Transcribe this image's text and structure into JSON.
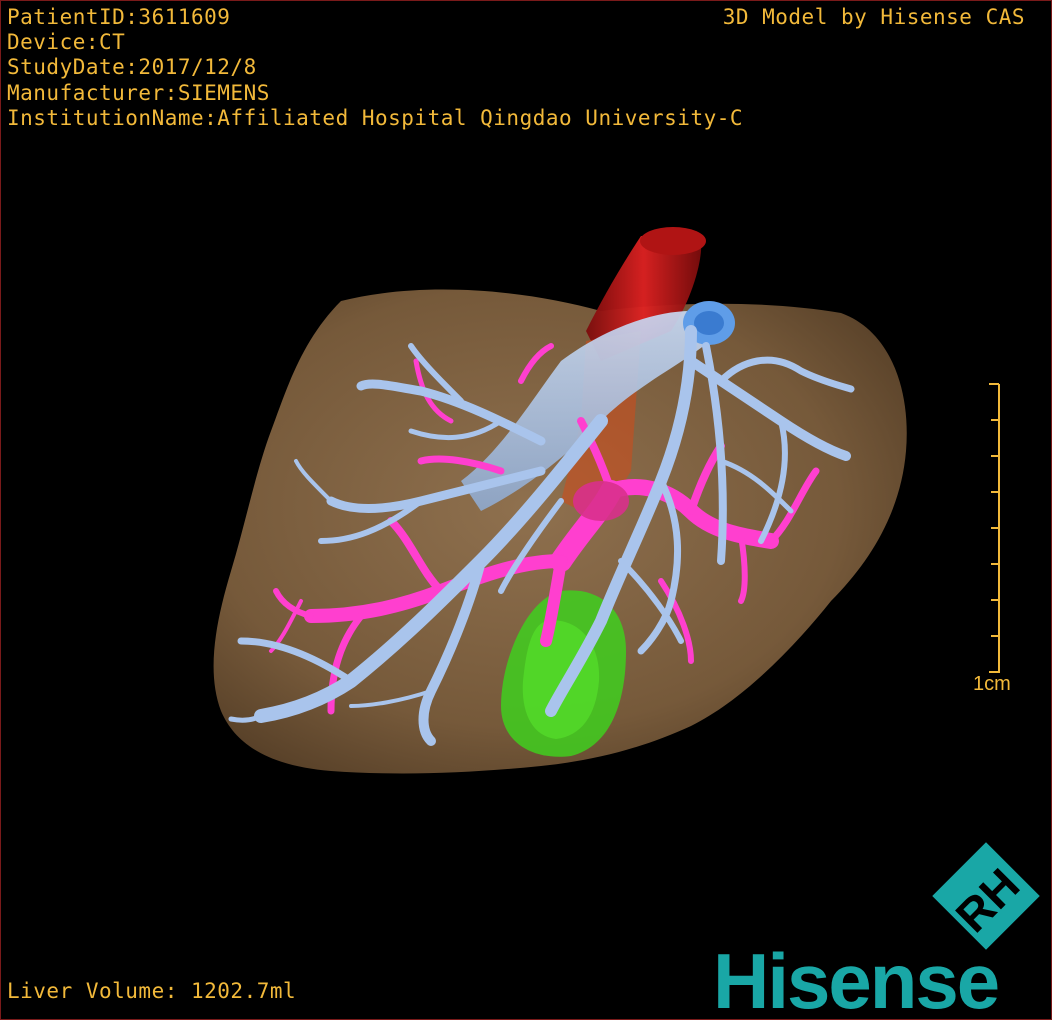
{
  "header": {
    "patient_id": "PatientID:3611609",
    "device": "Device:CT",
    "study_date": "StudyDate:2017/12/8",
    "manufacturer": "Manufacturer:SIEMENS",
    "institution": "InstitutionName:Affiliated Hospital Qingdao University-C",
    "model_credit": "3D Model by Hisense CAS"
  },
  "footer": {
    "liver_volume": "Liver Volume: 1202.7ml"
  },
  "scale_bar": {
    "label": "1cm"
  },
  "brand": {
    "name": "Hisense",
    "logo_text": "RH",
    "color": "#19a7a6"
  },
  "colors": {
    "text": "#f2b93a",
    "liver": "#8a6a47",
    "portal_vein": "#ff3fcf",
    "hepatic_vein": "#a9c4ec",
    "vena_cava": "#d01818",
    "gallbladder": "#3fcf1f"
  }
}
